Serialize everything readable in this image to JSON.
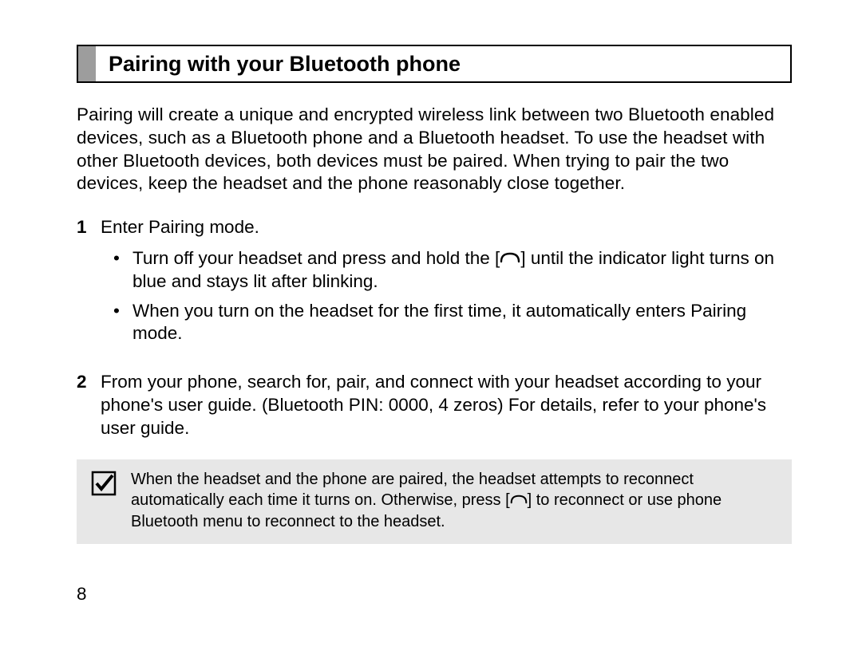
{
  "heading": "Pairing with your Bluetooth phone",
  "intro": "Pairing will create a unique and encrypted wireless link between two Bluetooth enabled devices, such as a Bluetooth phone and a Bluetooth headset. To use the headset with other Bluetooth devices, both devices must be paired. When trying to pair the two devices, keep the headset and the phone reasonably close together.",
  "steps": [
    {
      "num": "1",
      "text": "Enter Pairing mode.",
      "sub": [
        {
          "pre": "Turn off your headset and press and hold the [",
          "post": "] until the indicator light turns on blue and stays lit after blinking."
        },
        {
          "plain": "When you turn on the headset for the first time, it automatically enters Pairing mode."
        }
      ]
    },
    {
      "num": "2",
      "text": "From your phone, search for, pair, and connect with your headset according to your phone's user guide. (Bluetooth PIN: 0000, 4 zeros) For details, refer to your phone's user guide."
    }
  ],
  "note": {
    "pre": "When the headset and the phone are paired, the headset attempts to reconnect automatically each time it turns on. Otherwise, press [",
    "post": "] to reconnect or use phone Bluetooth menu to reconnect to the headset."
  },
  "pageNumber": "8",
  "icons": {
    "turnkey": "turnkey-icon",
    "check": "check-icon"
  }
}
